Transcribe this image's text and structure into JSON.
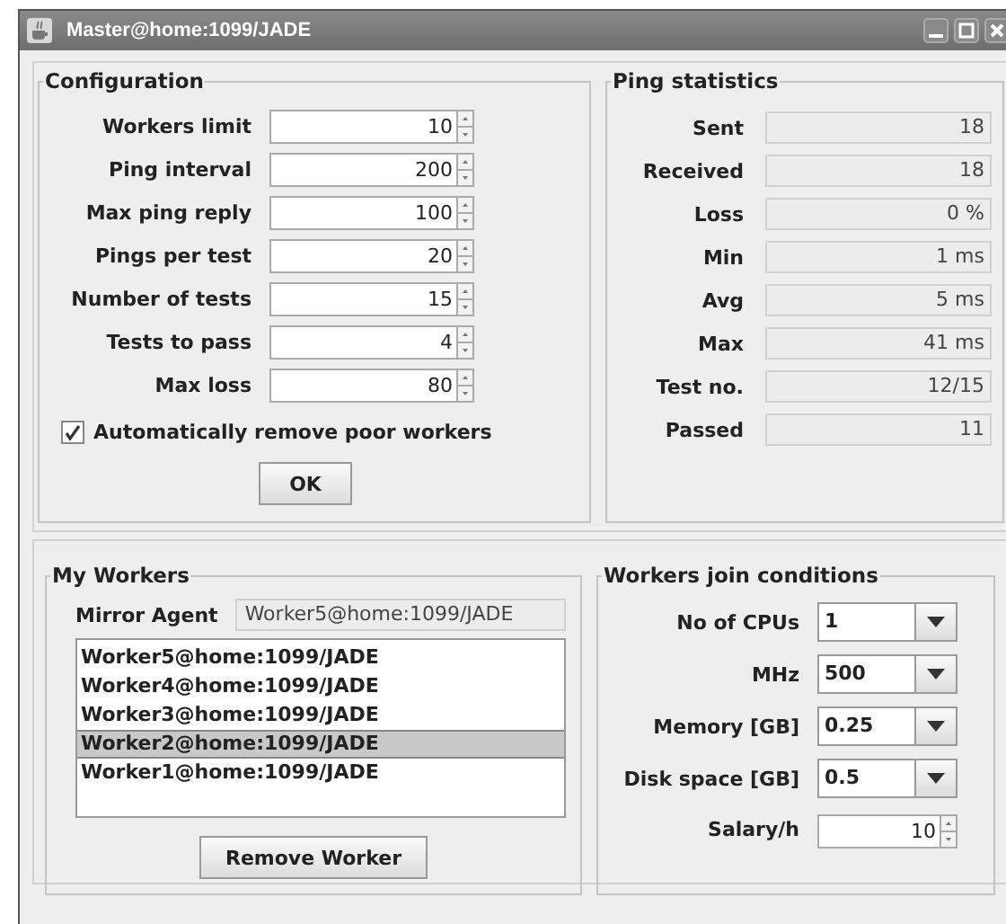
{
  "window": {
    "title": "Master@home:1099/JADE"
  },
  "configuration": {
    "title": "Configuration",
    "fields": [
      {
        "label": "Workers limit",
        "value": "10"
      },
      {
        "label": "Ping interval",
        "value": "200"
      },
      {
        "label": "Max ping reply",
        "value": "100"
      },
      {
        "label": "Pings per test",
        "value": "20"
      },
      {
        "label": "Number of tests",
        "value": "15"
      },
      {
        "label": "Tests to pass",
        "value": "4"
      },
      {
        "label": "Max loss",
        "value": "80"
      }
    ],
    "auto_remove": {
      "label": "Automatically remove poor workers",
      "checked": true
    },
    "ok_button": "OK"
  },
  "ping_statistics": {
    "title": "Ping statistics",
    "rows": [
      {
        "label": "Sent",
        "value": "18"
      },
      {
        "label": "Received",
        "value": "18"
      },
      {
        "label": "Loss",
        "value": "0 %"
      },
      {
        "label": "Min",
        "value": "1 ms"
      },
      {
        "label": "Avg",
        "value": "5 ms"
      },
      {
        "label": "Max",
        "value": "41 ms"
      },
      {
        "label": "Test no.",
        "value": "12/15"
      },
      {
        "label": "Passed",
        "value": "11"
      }
    ]
  },
  "my_workers": {
    "title": "My Workers",
    "mirror_agent": {
      "label": "Mirror Agent",
      "value": "Worker5@home:1099/JADE"
    },
    "workers": [
      {
        "name": "Worker5@home:1099/JADE",
        "selected": false
      },
      {
        "name": "Worker4@home:1099/JADE",
        "selected": false
      },
      {
        "name": "Worker3@home:1099/JADE",
        "selected": false
      },
      {
        "name": "Worker2@home:1099/JADE",
        "selected": true
      },
      {
        "name": "Worker1@home:1099/JADE",
        "selected": false
      }
    ],
    "remove_button": "Remove Worker"
  },
  "join_conditions": {
    "title": "Workers join conditions",
    "fields": [
      {
        "kind": "combo",
        "label": "No of CPUs",
        "value": "1"
      },
      {
        "kind": "combo",
        "label": "MHz",
        "value": "500"
      },
      {
        "kind": "combo",
        "label": "Memory [GB]",
        "value": "0.25"
      },
      {
        "kind": "combo",
        "label": "Disk space [GB]",
        "value": "0.5"
      },
      {
        "kind": "spinner",
        "label": "Salary/h",
        "value": "10"
      }
    ]
  }
}
